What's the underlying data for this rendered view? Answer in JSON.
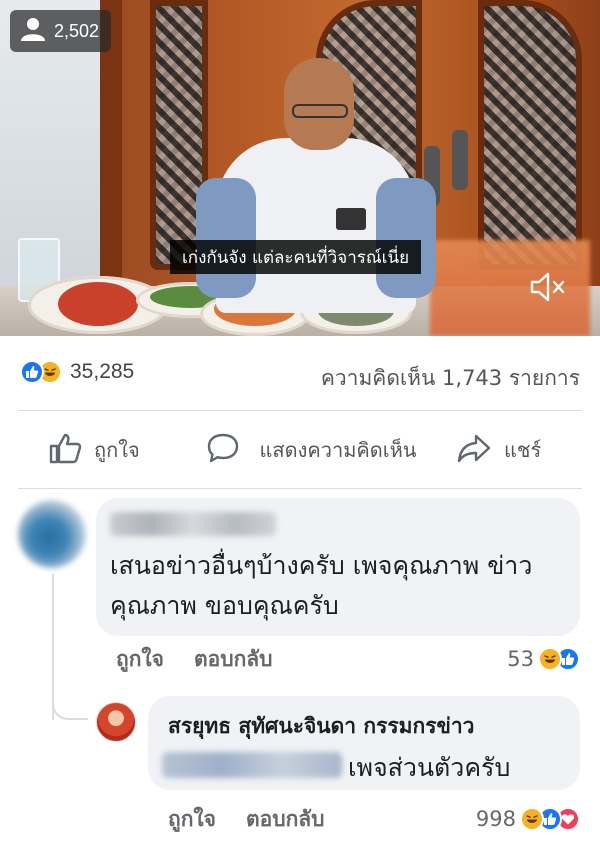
{
  "video": {
    "viewer_count": "2,502",
    "caption": "เก่งกันจัง แต่ละคนที่วิจารณ์เนี่ย"
  },
  "stats": {
    "reaction_count": "35,285",
    "comment_count": "ความคิดเห็น 1,743 รายการ"
  },
  "actions": {
    "like": "ถูกใจ",
    "comment": "แสดงความคิดเห็น",
    "share": "แชร์"
  },
  "comments": [
    {
      "author": "",
      "text": "เสนอข่าวอื่นๆบ้างครับ เพจคุณภาพ ข่าวคุณภาพ ขอบคุณครับ",
      "like_label": "ถูกใจ",
      "reply_label": "ตอบกลับ",
      "reaction_count": "53",
      "reactions": [
        "haha",
        "like"
      ]
    },
    {
      "author": "สรยุทธ สุทัศนะจินดา กรรมกรข่าว",
      "text": "เพจส่วนตัวครับ",
      "like_label": "ถูกใจ",
      "reply_label": "ตอบกลับ",
      "reaction_count": "998",
      "reactions": [
        "haha",
        "like",
        "love"
      ]
    }
  ],
  "colors": {
    "like_blue": "#1877f2",
    "haha_yellow": "#f7b125",
    "love_red": "#f33e58",
    "bubble_bg": "#f0f2f5"
  }
}
